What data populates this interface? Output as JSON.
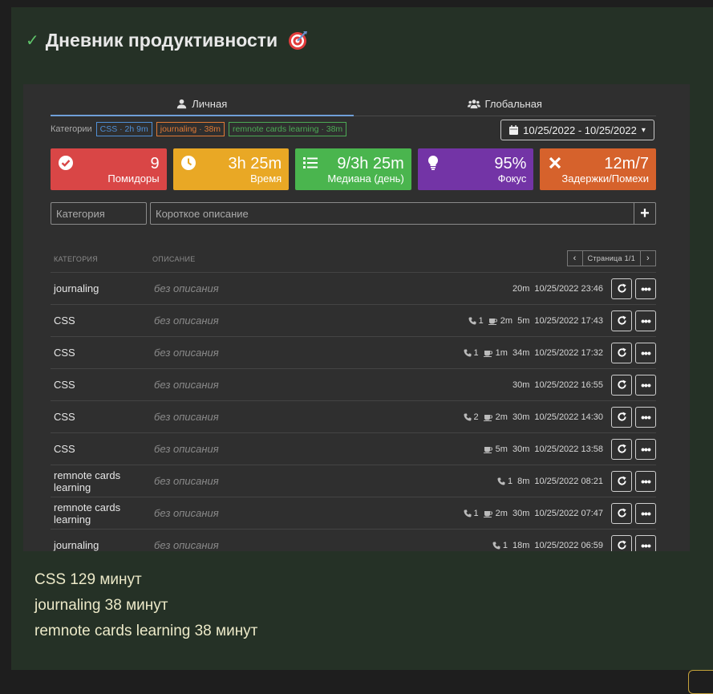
{
  "page": {
    "title": "Дневник продуктивности",
    "emoji": "🎯"
  },
  "tabs": [
    {
      "label": "Личная",
      "active": true,
      "icon": "user-icon"
    },
    {
      "label": "Глобальная",
      "active": false,
      "icon": "users-icon"
    }
  ],
  "categories": {
    "label": "Категории",
    "tags": [
      {
        "text": "CSS · 2h 9m",
        "color": "#4f8fd6"
      },
      {
        "text": "journaling · 38m",
        "color": "#e07a35"
      },
      {
        "text": "remnote cards learning · 38m",
        "color": "#4caa55"
      }
    ]
  },
  "date_range": "10/25/2022 - 10/25/2022",
  "stats": [
    {
      "value": "9",
      "label": "Помидоры",
      "icon": "check-circle-icon",
      "color": "#d94646"
    },
    {
      "value": "3h 25m",
      "label": "Время",
      "icon": "clock-icon",
      "color": "#e9a825"
    },
    {
      "value": "9/3h 25m",
      "label": "Медиана (день)",
      "icon": "list-icon",
      "color": "#4ab54e"
    },
    {
      "value": "95%",
      "label": "Фокус",
      "icon": "lightbulb-icon",
      "color": "#7334a6"
    },
    {
      "value": "12m/7",
      "label": "Задержки/Помехи",
      "icon": "times-icon",
      "color": "#d6622c"
    }
  ],
  "form": {
    "category_placeholder": "Категория",
    "description_placeholder": "Короткое описание",
    "add_label": "+"
  },
  "table": {
    "headers": {
      "category": "КАТЕГОРИЯ",
      "description": "ОПИСАНИЕ"
    },
    "pager": {
      "prev": "‹",
      "info": "Страница 1/1",
      "next": "›"
    },
    "rows": [
      {
        "category": "journaling",
        "description": "без описания",
        "calls": "",
        "breaks": "",
        "duration": "20m",
        "datetime": "10/25/2022 23:46"
      },
      {
        "category": "CSS",
        "description": "без описания",
        "calls": "1",
        "breaks": "2m",
        "duration": "5m",
        "datetime": "10/25/2022 17:43"
      },
      {
        "category": "CSS",
        "description": "без описания",
        "calls": "1",
        "breaks": "1m",
        "duration": "34m",
        "datetime": "10/25/2022 17:32"
      },
      {
        "category": "CSS",
        "description": "без описания",
        "calls": "",
        "breaks": "",
        "duration": "30m",
        "datetime": "10/25/2022 16:55"
      },
      {
        "category": "CSS",
        "description": "без описания",
        "calls": "2",
        "breaks": "2m",
        "duration": "30m",
        "datetime": "10/25/2022 14:30"
      },
      {
        "category": "CSS",
        "description": "без описания",
        "calls": "",
        "breaks": "5m",
        "duration": "30m",
        "datetime": "10/25/2022 13:58"
      },
      {
        "category": "remnote cards learning",
        "description": "без описания",
        "calls": "1",
        "breaks": "",
        "duration": "8m",
        "datetime": "10/25/2022 08:21"
      },
      {
        "category": "remnote cards learning",
        "description": "без описания",
        "calls": "1",
        "breaks": "2m",
        "duration": "30m",
        "datetime": "10/25/2022 07:47"
      },
      {
        "category": "journaling",
        "description": "без описания",
        "calls": "1",
        "breaks": "",
        "duration": "18m",
        "datetime": "10/25/2022 06:59"
      }
    ]
  },
  "summary": [
    "CSS 129 минут",
    "journaling 38 минут",
    "remnote cards learning 38 минут"
  ]
}
